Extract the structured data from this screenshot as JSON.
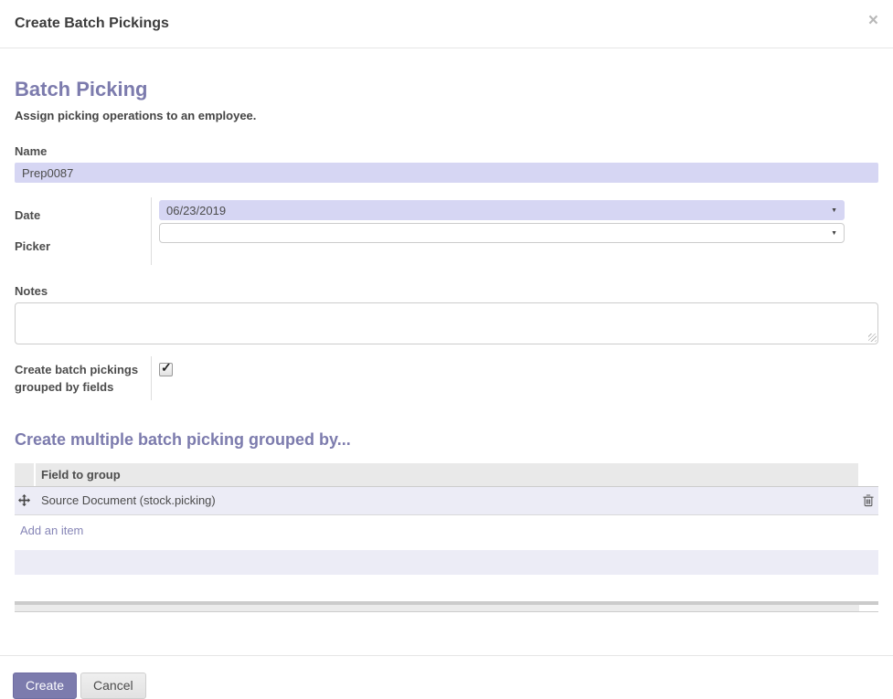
{
  "modal": {
    "title": "Create Batch Pickings"
  },
  "icons": {
    "close": "×",
    "dropdown": "▼",
    "checkmark": "✓"
  },
  "form": {
    "heading": "Batch Picking",
    "subtitle": "Assign picking operations to an employee.",
    "name_label": "Name",
    "name_value": "Prep0087",
    "date_label": "Date",
    "date_value": "06/23/2019",
    "picker_label": "Picker",
    "picker_value": "",
    "notes_label": "Notes",
    "notes_value": "",
    "grouped_label": "Create batch pickings grouped by fields",
    "grouped_checked": true
  },
  "group_section": {
    "heading": "Create multiple batch picking grouped by...",
    "table": {
      "column_header": "Field to group",
      "rows": [
        "Source Document (stock.picking)"
      ],
      "add_item_label": "Add an item"
    }
  },
  "footer": {
    "create_label": "Create",
    "cancel_label": "Cancel"
  },
  "colors": {
    "accent": "#7c7bad",
    "highlight_input_bg": "#d6d6f3",
    "highlight_row_bg": "#ececf6"
  }
}
